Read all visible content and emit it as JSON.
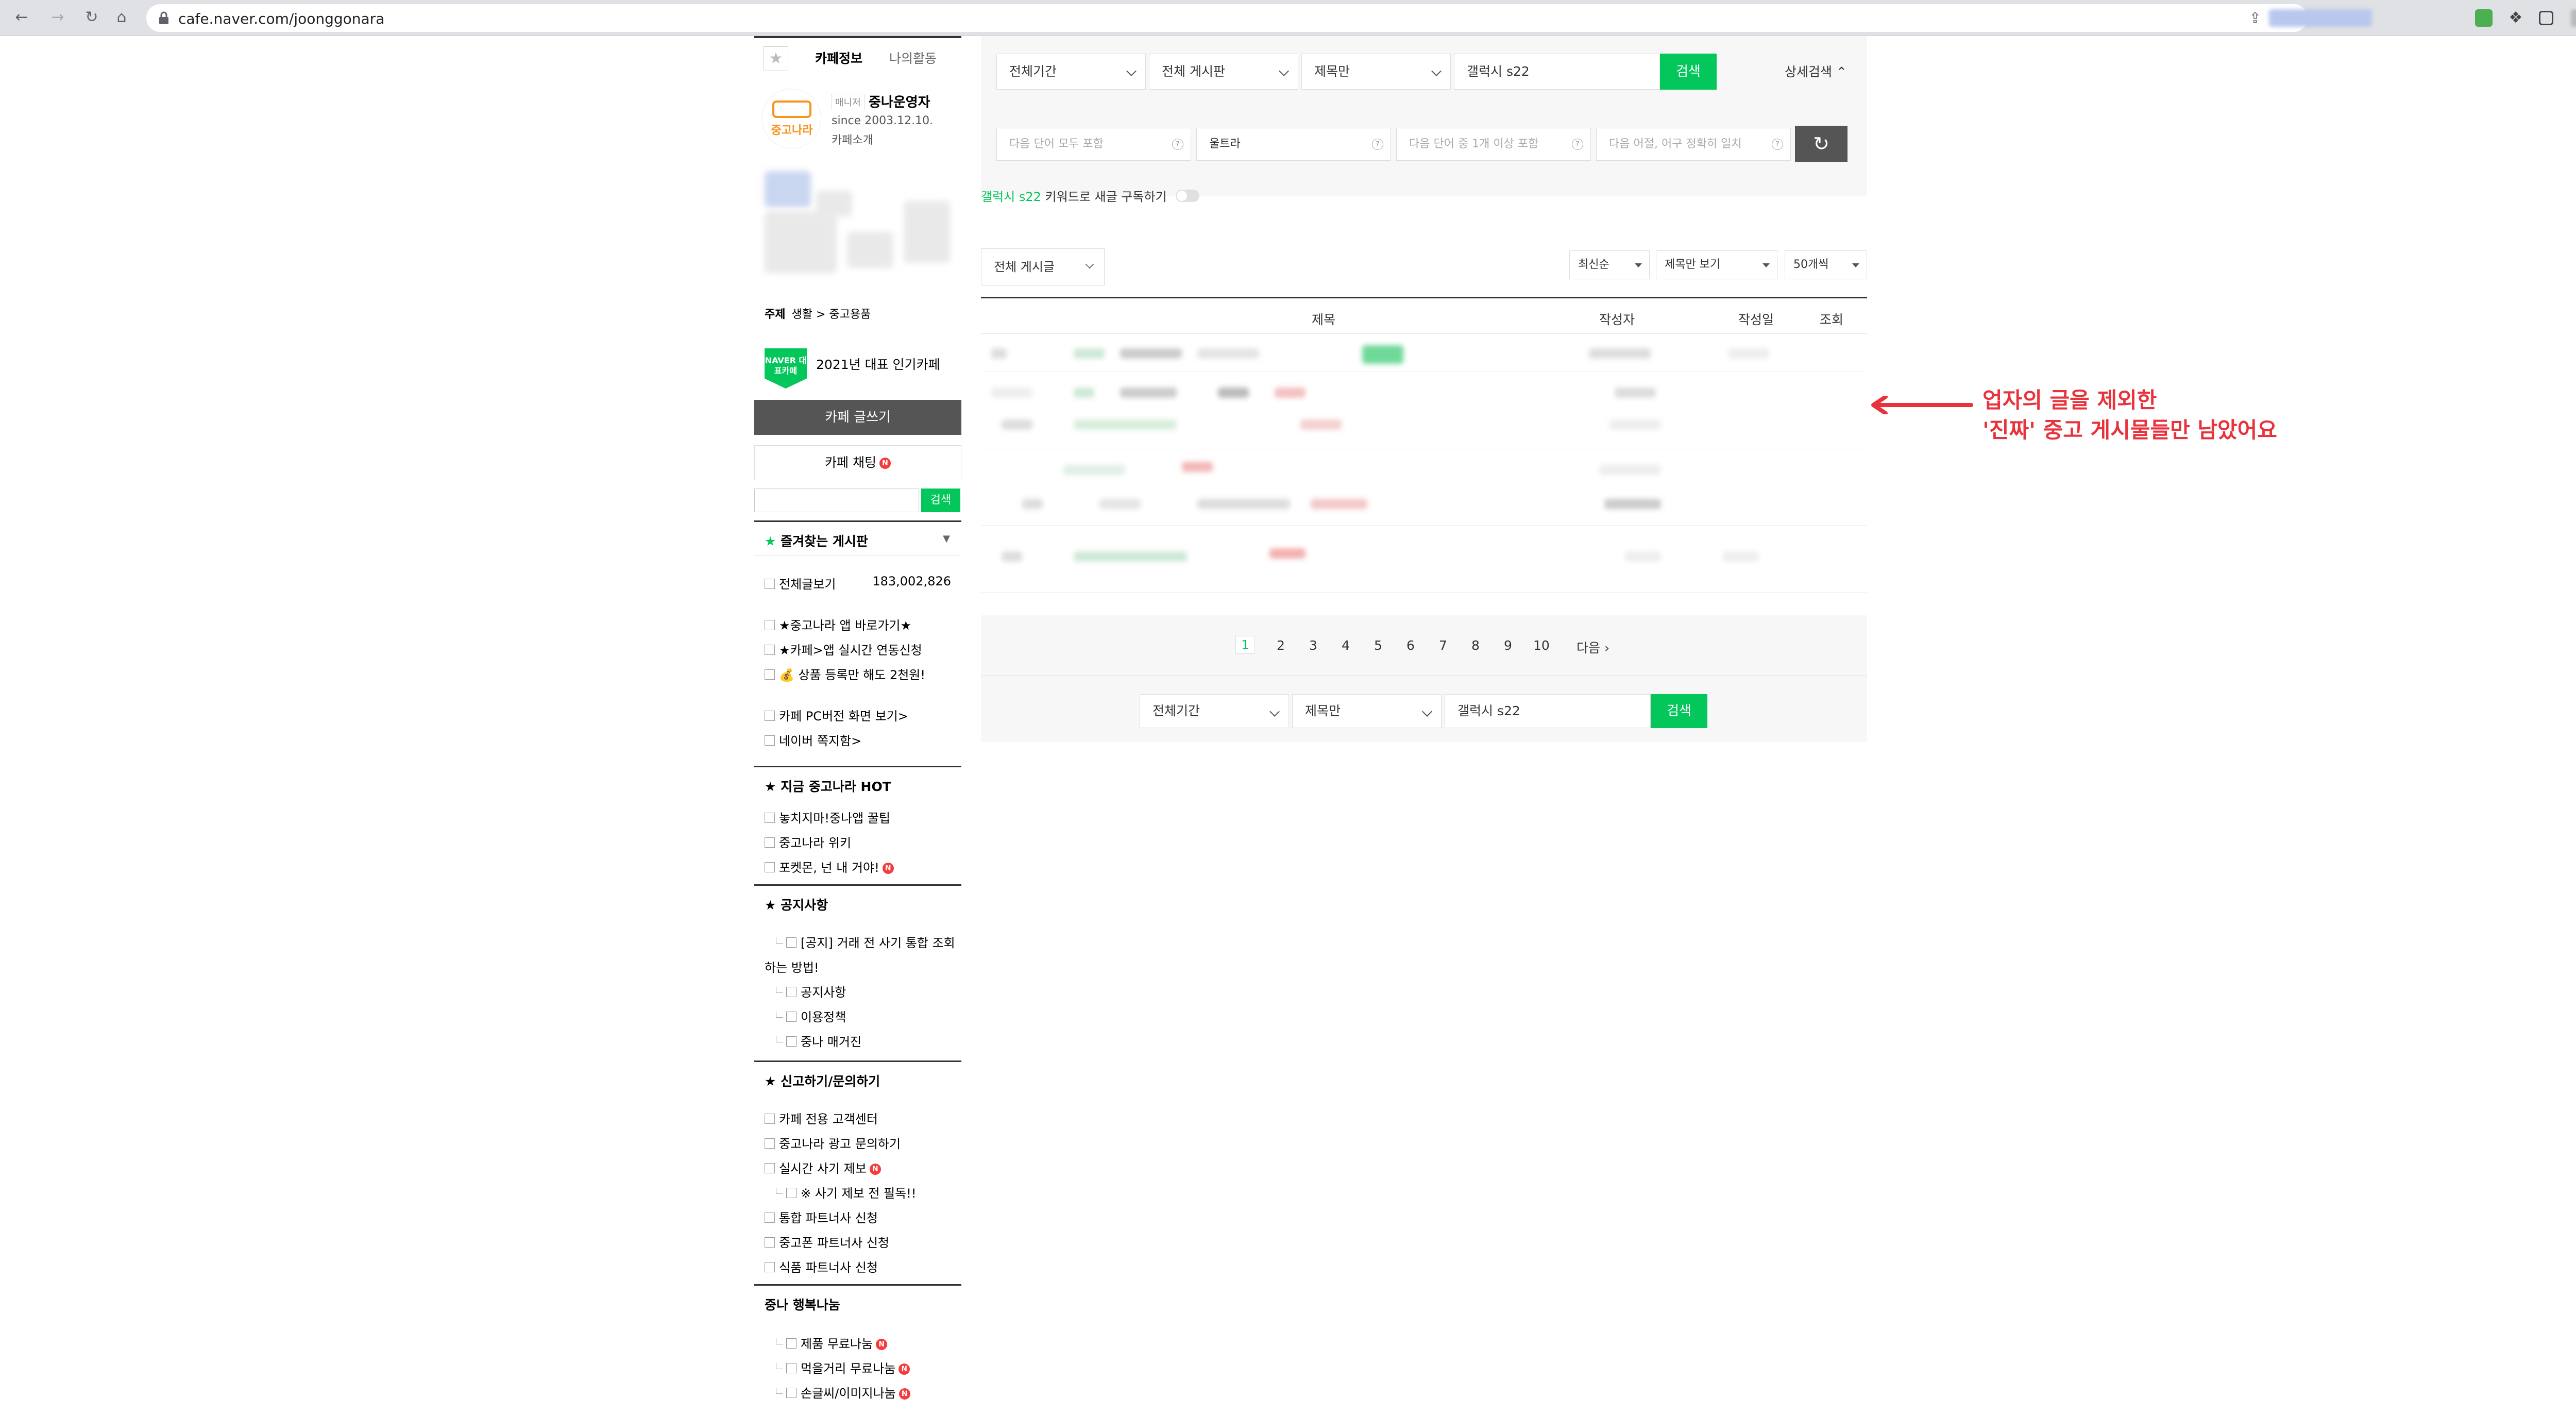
{
  "browser": {
    "url": "cafe.naver.com/joonggonara"
  },
  "sidebar": {
    "tabs": [
      "카페정보",
      "나의활동"
    ],
    "manager_badge": "매니저",
    "manager_name": "중나운영자",
    "since": "since 2003.12.10.",
    "intro": "카페소개",
    "logo_text": "중고나라",
    "topic_label": "주제",
    "topic_value": "생활 > 중고용품",
    "award_badge": "NAVER 대표카페",
    "award_text": "2021년 대표 인기카페",
    "write_button": "카페 글쓰기",
    "chat_button": "카페 채팅",
    "search_button": "검색",
    "favorites_title": "즐겨찾는 게시판",
    "all_posts_label": "전체글보기",
    "all_posts_count": "183,002,826",
    "group1": [
      "★중고나라 앱 바로가기★",
      "★카페>앱 실시간 연동신청",
      "💰 상품 등록만 해도 2천원!"
    ],
    "group2": [
      "카페 PC버전 화면 보기>",
      "네이버 쪽지함>"
    ],
    "hot_title": "★ 지금 중고나라 HOT",
    "hot_items": [
      "놓치지마!중나앱 꿀팁",
      "중고나라 위키",
      "포켓몬, 넌 내 거야!"
    ],
    "notice_title": "★ 공지사항",
    "notice_items": [
      "[공지] 거래 전 사기 통합 조회",
      "하는 방법!",
      "공지사항",
      "이용정책",
      "중나 매거진"
    ],
    "report_title": "★ 신고하기/문의하기",
    "report_items": [
      "카페 전용 고객센터",
      "중고나라 광고 문의하기",
      "실시간 사기 제보",
      "※ 사기 제보 전 필독!!",
      "통합 파트너사 신청",
      "중고폰 파트너사 신청",
      "식품 파트너사 신청"
    ],
    "share_title": "중나 행복나눔",
    "share_items": [
      "제품 무료나눔",
      "먹을거리 무료나눔",
      "손글씨/이미지나눔"
    ],
    "new_badge": "N"
  },
  "search": {
    "period": "전체기간",
    "board": "전체 게시판",
    "scope": "제목만",
    "query": "갤럭시 s22",
    "search_button": "검색",
    "detail_label": "상세검색",
    "all_words_placeholder": "다음 단어 모두 포함",
    "exclude_value": "울트라",
    "any_words_placeholder": "다음 단어 중 1개 이상 포함",
    "exact_placeholder": "다음 어절, 어구 정확히 일치",
    "help_mark": "?"
  },
  "keyword_sub": {
    "keyword": "갤럭시 s22",
    "text": " 키워드로 새글 구독하기"
  },
  "list": {
    "board_filter": "전체 게시글",
    "sort": "최신순",
    "view_mode": "제목만 보기",
    "per_page": "50개씩",
    "columns": [
      "제목",
      "작성자",
      "작성일",
      "조회"
    ]
  },
  "pagination": {
    "pages": [
      "1",
      "2",
      "3",
      "4",
      "5",
      "6",
      "7",
      "8",
      "9",
      "10"
    ],
    "next": "다음"
  },
  "bottom_search": {
    "period": "전체기간",
    "scope": "제목만",
    "query": "갤럭시 s22",
    "button": "검색"
  },
  "annotation": {
    "line1": "업자의 글을 제외한",
    "line2": "'진짜' 중고 게시물들만 남았어요",
    "color": "#e8323c"
  },
  "colors": {
    "accent": "#03c75a",
    "dark_button": "#555555"
  }
}
